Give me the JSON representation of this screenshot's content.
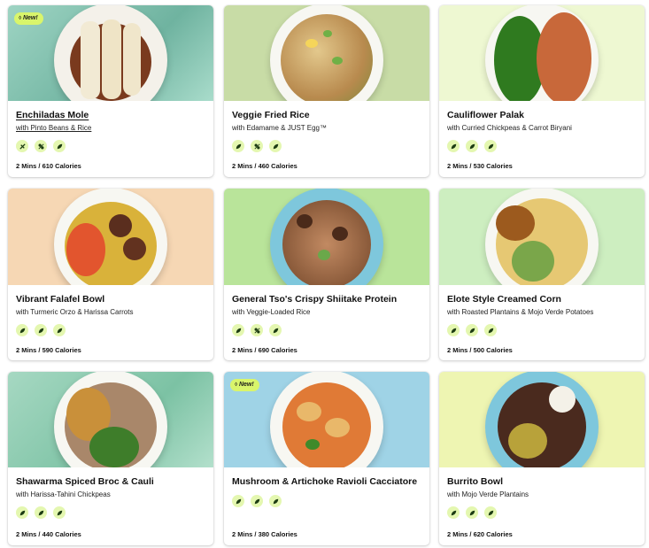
{
  "cards": [
    {
      "title": "Enchiladas Mole",
      "subtitle": "with Pinto Beans & Rice",
      "meta": "2 Mins / 610 Calories",
      "badge": "New!",
      "bg": "#8fc9b6",
      "icons": [
        "flash-icon",
        "clover-icon",
        "leaf-icon"
      ]
    },
    {
      "title": "Veggie Fried Rice",
      "subtitle": "with Edamame & JUST Egg™",
      "meta": "2 Mins / 460 Calories",
      "bg": "#c7dca4",
      "icons": [
        "leaf-icon",
        "clover-icon",
        "leaf-icon"
      ]
    },
    {
      "title": "Cauliflower Palak",
      "subtitle": "with Curried Chickpeas & Carrot Biryani",
      "meta": "2 Mins / 530 Calories",
      "bg": "#eef8d2",
      "icons": [
        "leaf-icon",
        "leaf-icon",
        "leaf-icon"
      ]
    },
    {
      "title": "Vibrant Falafel Bowl",
      "subtitle": "with Turmeric Orzo & Harissa Carrots",
      "meta": "2 Mins / 590 Calories",
      "bg": "#f6d7b4",
      "icons": [
        "leaf-icon",
        "leaf-icon",
        "leaf-icon"
      ]
    },
    {
      "title": "General Tso's Crispy Shiitake Protein",
      "subtitle": "with Veggie-Loaded Rice",
      "meta": "2 Mins / 690 Calories",
      "bg": "#b9e49a",
      "icons": [
        "leaf-icon",
        "clover-icon",
        "leaf-icon"
      ]
    },
    {
      "title": "Elote Style Creamed Corn",
      "subtitle": "with Roasted Plantains & Mojo Verde Potatoes",
      "meta": "2 Mins / 500 Calories",
      "bg": "#cdeec0",
      "icons": [
        "leaf-icon",
        "leaf-icon",
        "leaf-icon"
      ]
    },
    {
      "title": "Shawarma Spiced Broc & Cauli",
      "subtitle": "with Harissa-Tahini Chickpeas",
      "meta": "2 Mins / 440 Calories",
      "bg": "#a6d8c2",
      "icons": [
        "leaf-icon",
        "leaf-icon",
        "leaf-icon"
      ]
    },
    {
      "title": "Mushroom & Artichoke Ravioli Cacciatore",
      "subtitle": "",
      "meta": "2 Mins / 380 Calories",
      "badge": "New!",
      "bg": "#9fd3e6",
      "icons": [
        "leaf-icon",
        "leaf-icon",
        "leaf-icon"
      ]
    },
    {
      "title": "Burrito Bowl",
      "subtitle": "with Mojo Verde Plantains",
      "meta": "2 Mins / 620 Calories",
      "bg": "#eef5b2",
      "icons": [
        "leaf-icon",
        "leaf-icon",
        "leaf-icon"
      ]
    }
  ]
}
